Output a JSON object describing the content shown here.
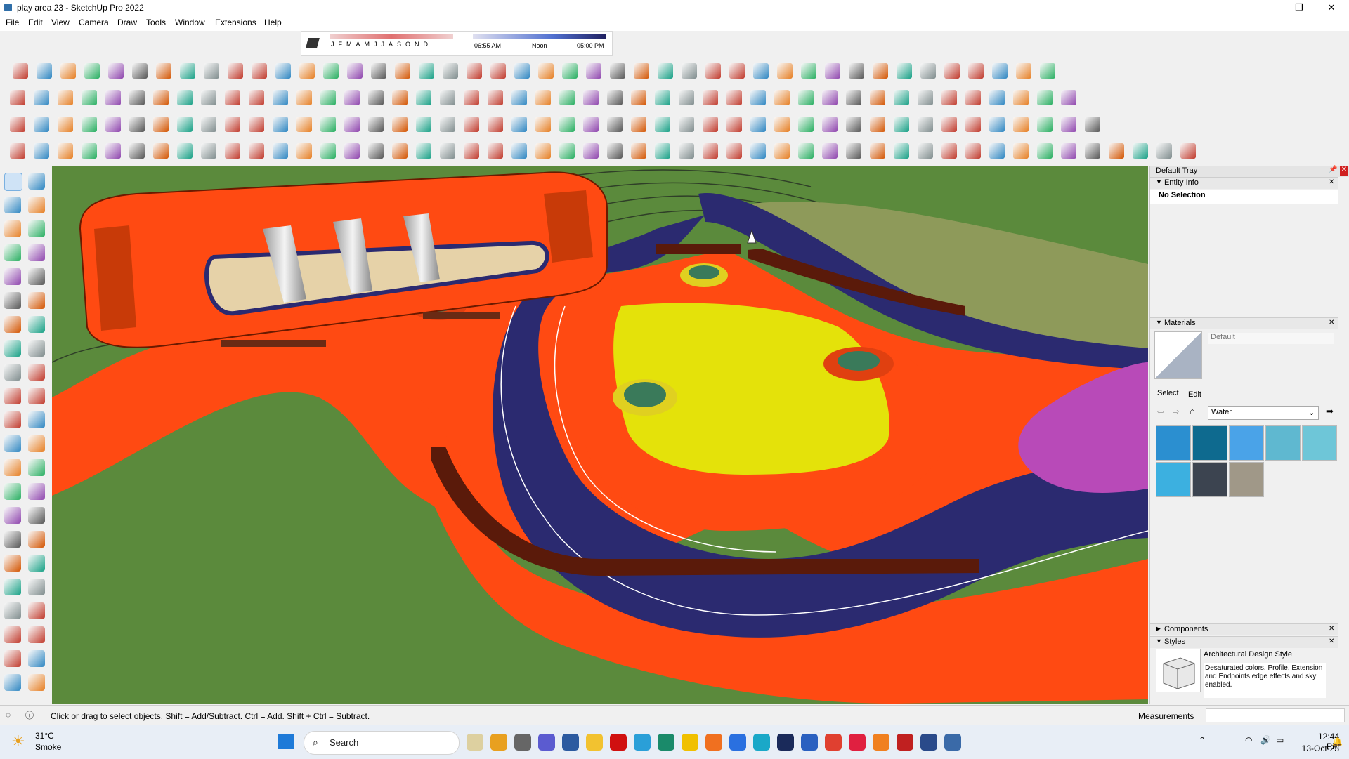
{
  "window": {
    "title": "play area 23 - SketchUp Pro 2022",
    "minimize": "–",
    "maximize": "❐",
    "close": "✕"
  },
  "menu": [
    "File",
    "Edit",
    "View",
    "Camera",
    "Draw",
    "Tools",
    "Window",
    "Extensions",
    "Help"
  ],
  "shadows": {
    "months": "JFMAMJJASOND",
    "time_start": "06:55 AM",
    "time_mid": "Noon",
    "time_end": "05:00 PM"
  },
  "tray": {
    "title": "Default Tray",
    "entity_info": {
      "header": "Entity Info",
      "value": "No Selection"
    },
    "materials": {
      "header": "Materials",
      "current": "Default",
      "tab_select": "Select",
      "tab_edit": "Edit",
      "library": "Water",
      "swatches": [
        "#2b8fd0",
        "#0e6a8f",
        "#4aa3e8",
        "#5fb8d0",
        "#6ec6d8",
        "#3cb0e0",
        "#3c4450",
        "#a09888"
      ]
    },
    "components": {
      "header": "Components"
    },
    "styles": {
      "header": "Styles",
      "name": "Architectural Design Style",
      "description": "Desaturated colors. Profile, Extension and Endpoints edge effects and sky enabled."
    }
  },
  "status": {
    "hint": "Click or drag to select objects. Shift = Add/Subtract. Ctrl = Add. Shift + Ctrl = Subtract.",
    "measurements_label": "Measurements"
  },
  "taskbar": {
    "weather_temp": "31°C",
    "weather_cond": "Smoke",
    "search": "Search",
    "time": "12:44 PM",
    "date": "13-Oct-23"
  },
  "colors": {
    "ground": "#5b8a3c",
    "path_orange": "#ff4a12",
    "track_navy": "#2b2a70",
    "pad_yellow": "#e4e20a",
    "pad_magenta": "#b84ab8"
  }
}
